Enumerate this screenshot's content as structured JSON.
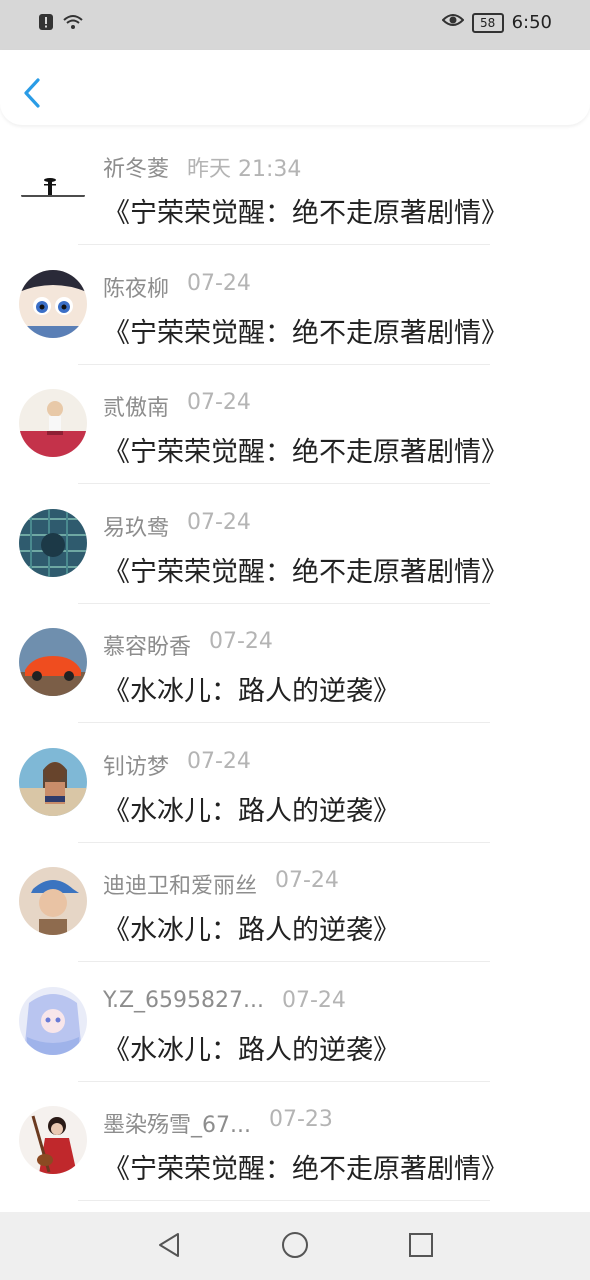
{
  "status": {
    "time": "6:50",
    "battery": "58"
  },
  "colors": {
    "accent": "#2a9ce6",
    "name": "#8d8d8d",
    "time": "#b4b4b4",
    "title": "#222222"
  },
  "items": [
    {
      "name": "祈冬菱",
      "time": "昨天 21:34",
      "title": "《宁荣荣觉醒：绝不走原著剧情》",
      "avatar": "ink-figure"
    },
    {
      "name": "陈夜柳",
      "time": "07-24",
      "title": "《宁荣荣觉醒：绝不走原著剧情》",
      "avatar": "anime-boy"
    },
    {
      "name": "贰傲南",
      "time": "07-24",
      "title": "《宁荣荣觉醒：绝不走原著剧情》",
      "avatar": "girl-red-skirt"
    },
    {
      "name": "易玖鸯",
      "time": "07-24",
      "title": "《宁荣荣觉醒：绝不走原著剧情》",
      "avatar": "blue-pattern"
    },
    {
      "name": "慕容盼香",
      "time": "07-24",
      "title": "《水冰儿：路人的逆袭》",
      "avatar": "orange-car"
    },
    {
      "name": "钊访梦",
      "time": "07-24",
      "title": "《水冰儿：路人的逆袭》",
      "avatar": "beach-woman"
    },
    {
      "name": "迪迪卫和爱丽丝",
      "time": "07-24",
      "title": "《水冰儿：路人的逆袭》",
      "avatar": "girl-blue-cap"
    },
    {
      "name": "Y.Z_6595827...",
      "time": "07-24",
      "title": "《水冰儿：路人的逆袭》",
      "avatar": "anime-girl"
    },
    {
      "name": "墨染殇雪_67...",
      "time": "07-23",
      "title": "《宁荣荣觉醒：绝不走原著剧情》",
      "avatar": "red-dress-girl"
    }
  ]
}
